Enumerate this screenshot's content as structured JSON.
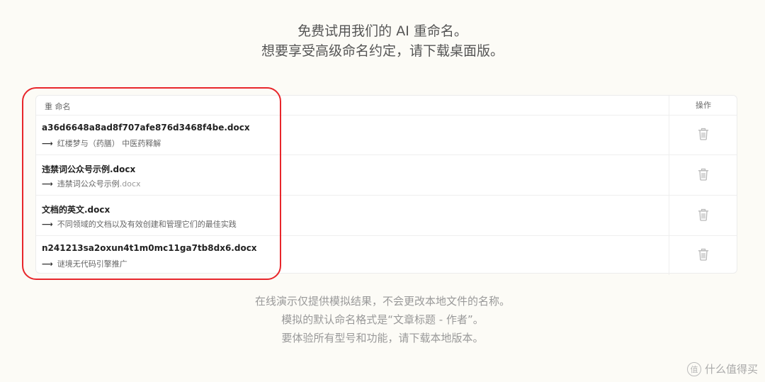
{
  "header": {
    "line1": "免费试用我们的 AI 重命名。",
    "line2": "想要享受高级命名约定，请下载桌面版。"
  },
  "table": {
    "col_name": "重 命名",
    "col_action": "操作",
    "arrow": "⟶",
    "rows": [
      {
        "original": "a36d6648a8ad8f707afe876d3468f4be.docx",
        "new_name": "红楼梦与（药膳） 中医药释解",
        "new_ext": "",
        "delete_icon": "trash-icon"
      },
      {
        "original": "违禁词公众号示例.docx",
        "new_name": "违禁词公众号示例",
        "new_ext": ".docx",
        "delete_icon": "trash-icon"
      },
      {
        "original": "文档的英文.docx",
        "new_name": "不同领域的文档以及有效创建和管理它们的最佳实践",
        "new_ext": "",
        "delete_icon": "trash-icon"
      },
      {
        "original": "n241213sa2oxun4t1m0mc11ga7tb8dx6.docx",
        "new_name": "谜境无代码引擎推广",
        "new_ext": "",
        "delete_icon": "trash-icon"
      }
    ]
  },
  "footer": {
    "line1": "在线演示仅提供模拟结果，不会更改本地文件的名称。",
    "line2": "模拟的默认命名格式是“文章标题 - 作者”。",
    "line3": "要体验所有型号和功能，请下载本地版本。"
  },
  "watermark": {
    "logo_text": "值",
    "text": "什么值得买"
  },
  "colors": {
    "background": "#fcfbf6",
    "highlight": "#e8262b"
  }
}
